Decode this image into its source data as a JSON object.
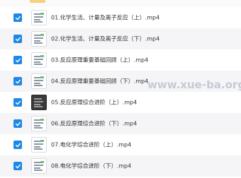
{
  "files": [
    {
      "name": "01.化学生活、计量及离子反应（上）.mp4",
      "checked": true,
      "thumb": "light"
    },
    {
      "name": "02.化学生活、计量及离子反应（下）.mp4",
      "checked": true,
      "thumb": "light"
    },
    {
      "name": "03.反应原理重要基础回顾（上）.mp4",
      "checked": true,
      "thumb": "light"
    },
    {
      "name": "04.反应原理重要基础回顾（下）.mp4",
      "checked": true,
      "thumb": "light"
    },
    {
      "name": "05.反应原理综合进阶（上）.mp4",
      "checked": true,
      "thumb": "dark"
    },
    {
      "name": "06.反应原理综合进阶（下）.mp4",
      "checked": true,
      "thumb": "light"
    },
    {
      "name": "07.电化学综合进阶（上）.mp4",
      "checked": true,
      "thumb": "light"
    },
    {
      "name": "08.电化学综合进阶（下）.mp4",
      "checked": true,
      "thumb": "light"
    }
  ],
  "watermark": "www.xue-ba.org",
  "colors": {
    "checkbox": "#1e88e5",
    "row_alt": "#f5f5f7",
    "text": "#333333"
  },
  "icons": {
    "checkbox": "checkbox-checked-icon",
    "thumbnail": "video-thumbnail-icon",
    "folder": "folder-icon"
  }
}
